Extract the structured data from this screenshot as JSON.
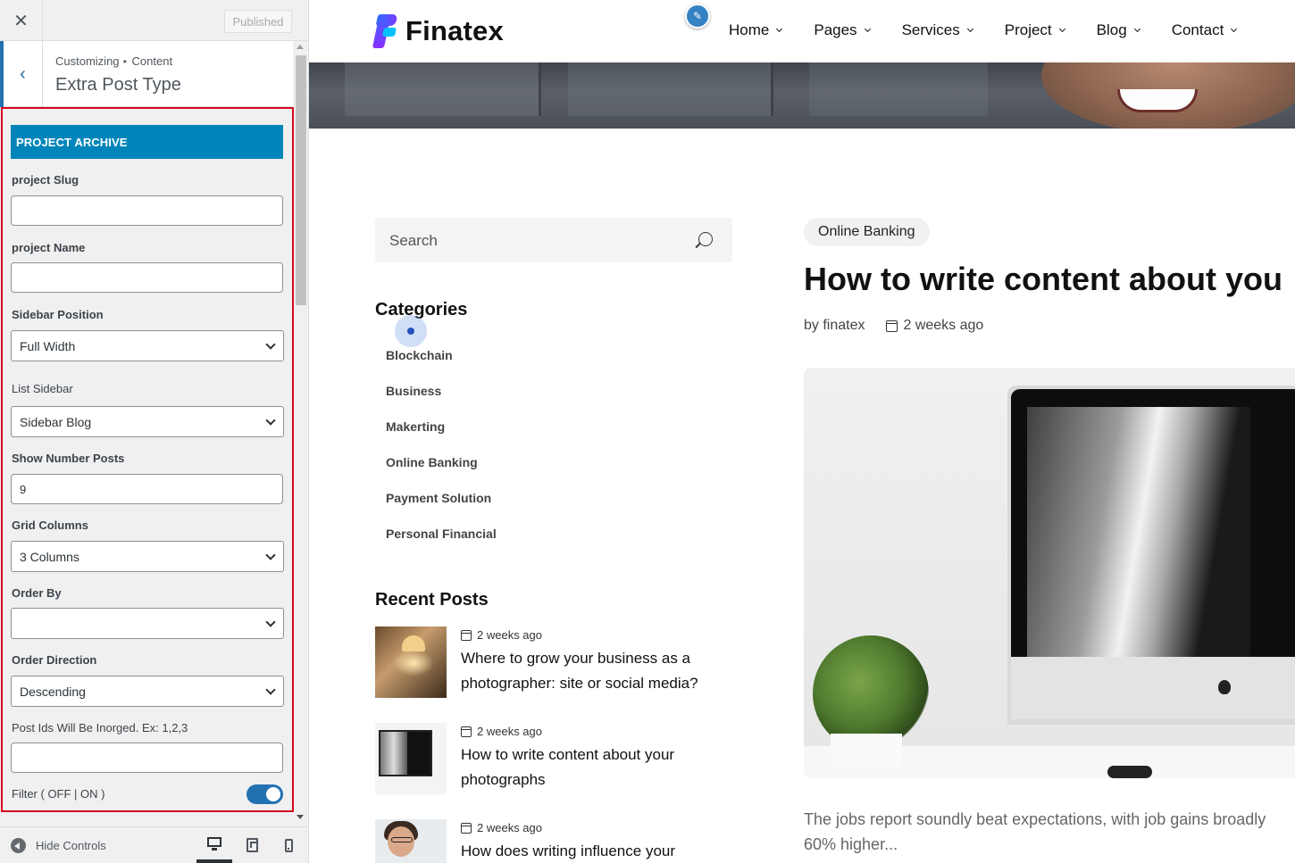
{
  "customizer": {
    "close_glyph": "✕",
    "publish_label": "Published",
    "back_glyph": "‹",
    "breadcrumb": [
      "Customizing",
      "Content"
    ],
    "breadcrumb_sep": "▸",
    "section_title": "Extra Post Type",
    "panel": {
      "heading": "PROJECT ARCHIVE",
      "fields": {
        "project_slug": {
          "label": "project Slug",
          "value": ""
        },
        "project_name": {
          "label": "project Name",
          "value": ""
        },
        "sidebar_position": {
          "label": "Sidebar Position",
          "value": "Full Width"
        },
        "list_sidebar": {
          "label": "List Sidebar",
          "value": "Sidebar Blog"
        },
        "show_number_posts": {
          "label": "Show Number Posts",
          "value": "9"
        },
        "grid_columns": {
          "label": "Grid Columns",
          "value": "3 Columns"
        },
        "order_by": {
          "label": "Order By",
          "value": ""
        },
        "order_direction": {
          "label": "Order Direction",
          "value": "Descending"
        },
        "post_ids": {
          "label": "Post Ids Will Be Inorged. Ex: 1,2,3",
          "value": ""
        },
        "filter": {
          "label": "Filter ( OFF | ON )",
          "on": true
        }
      }
    },
    "footer": {
      "hide_controls_label": "Hide Controls",
      "active_device": "desktop"
    }
  },
  "site": {
    "brand": "Finatex",
    "colors": {
      "accent": "#2271b1",
      "banner": "#0085ba",
      "highlight_border": "#d6081e"
    },
    "nav": [
      "Home",
      "Pages",
      "Services",
      "Project",
      "Blog",
      "Contact"
    ],
    "search": {
      "placeholder": "Search"
    },
    "categories_title": "Categories",
    "categories": [
      "Blockchain",
      "Business",
      "Makerting",
      "Online Banking",
      "Payment Solution",
      "Personal Financial"
    ],
    "recent_title": "Recent Posts",
    "recent_posts": [
      {
        "date": "2 weeks ago",
        "title": "Where to grow your business as a photographer: site or social media?"
      },
      {
        "date": "2 weeks ago",
        "title": "How to write content about your photographs"
      },
      {
        "date": "2 weeks ago",
        "title": "How does writing influence your"
      }
    ],
    "post": {
      "category": "Online Banking",
      "title": "How to write content about you",
      "author": "by finatex",
      "date": "2 weeks ago",
      "excerpt_line1": "The jobs report soundly beat expectations, with job gains broadly",
      "excerpt_line2": "60% higher..."
    }
  }
}
